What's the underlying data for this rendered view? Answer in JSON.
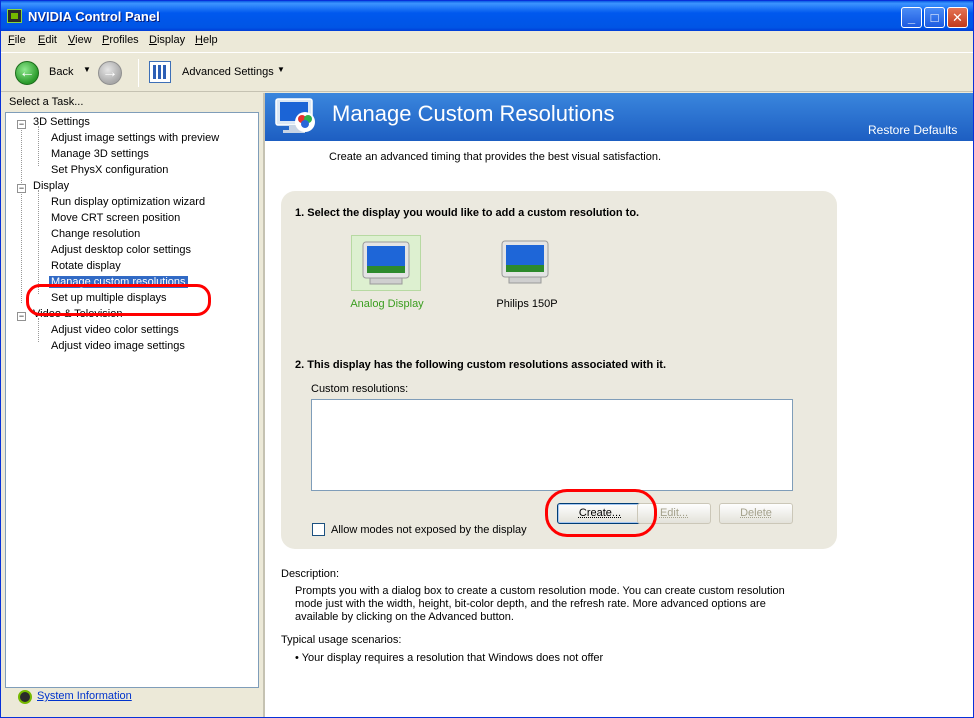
{
  "window": {
    "title": "NVIDIA Control Panel"
  },
  "menubar": [
    "File",
    "Edit",
    "View",
    "Profiles",
    "Display",
    "Help"
  ],
  "toolbar": {
    "back_label": "Back",
    "advanced_settings_label": "Advanced Settings"
  },
  "left_pane": {
    "header": "Select a Task...",
    "categories": [
      {
        "label": "3D Settings",
        "items": [
          "Adjust image settings with preview",
          "Manage 3D settings",
          "Set PhysX configuration"
        ]
      },
      {
        "label": "Display",
        "items": [
          "Run display optimization wizard",
          "Move CRT screen position",
          "Change resolution",
          "Adjust desktop color settings",
          "Rotate display",
          "Manage custom resolutions",
          "Set up multiple displays"
        ]
      },
      {
        "label": "Video & Television",
        "items": [
          "Adjust video color settings",
          "Adjust video image settings"
        ]
      }
    ],
    "selected_item": "Manage custom resolutions",
    "system_information": "System Information"
  },
  "right_pane": {
    "banner_title": "Manage Custom Resolutions",
    "restore_defaults": "Restore Defaults",
    "subtitle": "Create an advanced timing that provides the best visual satisfaction.",
    "step1": "1. Select the display you would like to add a custom resolution to.",
    "displays": [
      {
        "label": "Analog Display",
        "selected": true
      },
      {
        "label": "Philips  150P",
        "selected": false
      }
    ],
    "step2": "2. This display has the following custom resolutions associated with it.",
    "custom_resolutions_label": "Custom resolutions:",
    "buttons": {
      "create": "Create...",
      "edit": "Edit...",
      "delete": "Delete"
    },
    "allow_modes_label": "Allow modes not exposed by the display",
    "description_heading": "Description:",
    "description_body": "Prompts you with a dialog box to create a custom resolution mode. You can create custom resolution mode just with the width, height, bit-color depth, and the refresh rate. More advanced options are available by clicking on the Advanced button.",
    "usage_heading": "Typical usage scenarios:",
    "usage_item": "• Your display requires a resolution that Windows does not offer"
  },
  "colors": {
    "accent_banner": "#1d5ec2",
    "annotation_red": "#ff0000",
    "selected_green": "#3a9e1f"
  }
}
